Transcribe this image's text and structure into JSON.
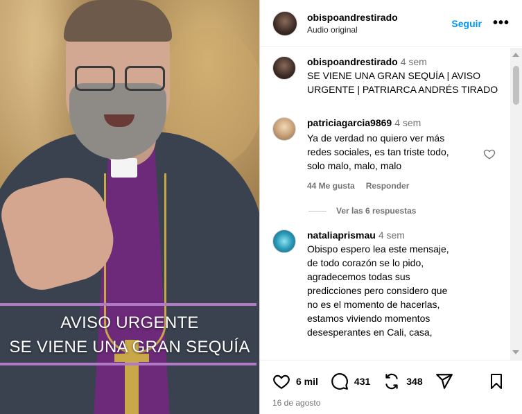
{
  "header": {
    "username": "obispoandrestirado",
    "subtitle": "Audio original",
    "follow_label": "Seguir",
    "more_label": "•••"
  },
  "video_overlay": {
    "line1": "AVISO URGENTE",
    "line2": "SE VIENE UNA GRAN SEQUÍA"
  },
  "caption": {
    "username": "obispoandrestirado",
    "time": "4 sem",
    "text": "SE VIENE UNA GRAN SEQUÍA | AVISO URGENTE | PATRIARCA ANDRÉS TIRADO"
  },
  "comments": [
    {
      "username": "patriciagarcia9869",
      "time": "4 sem",
      "text": "Ya de verdad no quiero ver más\nredes sociales, es tan triste todo,\nsolo malo, malo, malo",
      "likes_label": "44 Me gusta",
      "reply_label": "Responder",
      "view_replies_label": "Ver las 6 respuestas"
    },
    {
      "username": "nataliaprismau",
      "time": "4 sem",
      "text": "Obispo espero lea este mensaje,\nde todo corazón se lo pido,\nagradecemos todas sus\npredicciones pero considero que\nno es el momento de hacerlas,\nestamos viviendo momentos\ndesesperantes en Cali, casa,"
    }
  ],
  "footer": {
    "likes": "6 mil",
    "comments": "431",
    "reposts": "348",
    "date": "16 de agosto"
  },
  "colors": {
    "accent": "#0095f6",
    "overlay_line": "#b07ac8",
    "muted": "#737373"
  },
  "icons": [
    "heart-icon",
    "comment-icon",
    "repost-icon",
    "share-icon",
    "bookmark-icon",
    "more-icon"
  ]
}
